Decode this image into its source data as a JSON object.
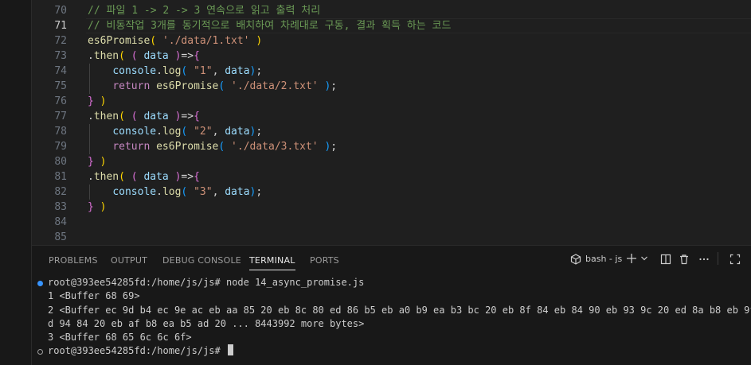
{
  "editor": {
    "lines": [
      {
        "n": "70",
        "segments": [
          {
            "c": "cm",
            "t": "// 파일 1 -> 2 -> 3 연속으로 읽고 출력 처리"
          }
        ]
      },
      {
        "n": "71",
        "active": true,
        "segments": [
          {
            "c": "cm",
            "t": "// 비동작업 3개를 동기적으로 배치하여 차례대로 구동, 결과 획득 하는 코드"
          }
        ]
      },
      {
        "n": "72",
        "segments": [
          {
            "c": "fn",
            "t": "es6Promise"
          },
          {
            "c": "b1",
            "t": "("
          },
          {
            "c": "pn",
            "t": " "
          },
          {
            "c": "str",
            "t": "'./data/1.txt'"
          },
          {
            "c": "pn",
            "t": " "
          },
          {
            "c": "b1",
            "t": ")"
          }
        ]
      },
      {
        "n": "73",
        "segments": [
          {
            "c": "pn",
            "t": "."
          },
          {
            "c": "fn",
            "t": "then"
          },
          {
            "c": "b1",
            "t": "("
          },
          {
            "c": "pn",
            "t": " "
          },
          {
            "c": "b2",
            "t": "("
          },
          {
            "c": "pn",
            "t": " "
          },
          {
            "c": "var",
            "t": "data"
          },
          {
            "c": "pn",
            "t": " "
          },
          {
            "c": "b2",
            "t": ")"
          },
          {
            "c": "op",
            "t": "=>"
          },
          {
            "c": "b2",
            "t": "{"
          }
        ]
      },
      {
        "n": "74",
        "guide": true,
        "segments": [
          {
            "c": "pn",
            "t": "    "
          },
          {
            "c": "var",
            "t": "console"
          },
          {
            "c": "pn",
            "t": "."
          },
          {
            "c": "fn",
            "t": "log"
          },
          {
            "c": "b3",
            "t": "("
          },
          {
            "c": "pn",
            "t": " "
          },
          {
            "c": "str",
            "t": "\"1\""
          },
          {
            "c": "pn",
            "t": ", "
          },
          {
            "c": "var",
            "t": "data"
          },
          {
            "c": "b3",
            "t": ")"
          },
          {
            "c": "pn",
            "t": ";"
          }
        ]
      },
      {
        "n": "75",
        "guide": true,
        "segments": [
          {
            "c": "pn",
            "t": "    "
          },
          {
            "c": "kw",
            "t": "return"
          },
          {
            "c": "pn",
            "t": " "
          },
          {
            "c": "fn",
            "t": "es6Promise"
          },
          {
            "c": "b3",
            "t": "("
          },
          {
            "c": "pn",
            "t": " "
          },
          {
            "c": "str",
            "t": "'./data/2.txt'"
          },
          {
            "c": "pn",
            "t": " "
          },
          {
            "c": "b3",
            "t": ")"
          },
          {
            "c": "pn",
            "t": ";"
          }
        ]
      },
      {
        "n": "76",
        "segments": [
          {
            "c": "b2",
            "t": "}"
          },
          {
            "c": "pn",
            "t": " "
          },
          {
            "c": "b1",
            "t": ")"
          }
        ]
      },
      {
        "n": "77",
        "segments": [
          {
            "c": "pn",
            "t": "."
          },
          {
            "c": "fn",
            "t": "then"
          },
          {
            "c": "b1",
            "t": "("
          },
          {
            "c": "pn",
            "t": " "
          },
          {
            "c": "b2",
            "t": "("
          },
          {
            "c": "pn",
            "t": " "
          },
          {
            "c": "var",
            "t": "data"
          },
          {
            "c": "pn",
            "t": " "
          },
          {
            "c": "b2",
            "t": ")"
          },
          {
            "c": "op",
            "t": "=>"
          },
          {
            "c": "b2",
            "t": "{"
          }
        ]
      },
      {
        "n": "78",
        "guide": true,
        "segments": [
          {
            "c": "pn",
            "t": "    "
          },
          {
            "c": "var",
            "t": "console"
          },
          {
            "c": "pn",
            "t": "."
          },
          {
            "c": "fn",
            "t": "log"
          },
          {
            "c": "b3",
            "t": "("
          },
          {
            "c": "pn",
            "t": " "
          },
          {
            "c": "str",
            "t": "\"2\""
          },
          {
            "c": "pn",
            "t": ", "
          },
          {
            "c": "var",
            "t": "data"
          },
          {
            "c": "b3",
            "t": ")"
          },
          {
            "c": "pn",
            "t": ";"
          }
        ]
      },
      {
        "n": "79",
        "guide": true,
        "segments": [
          {
            "c": "pn",
            "t": "    "
          },
          {
            "c": "kw",
            "t": "return"
          },
          {
            "c": "pn",
            "t": " "
          },
          {
            "c": "fn",
            "t": "es6Promise"
          },
          {
            "c": "b3",
            "t": "("
          },
          {
            "c": "pn",
            "t": " "
          },
          {
            "c": "str",
            "t": "'./data/3.txt'"
          },
          {
            "c": "pn",
            "t": " "
          },
          {
            "c": "b3",
            "t": ")"
          },
          {
            "c": "pn",
            "t": ";"
          }
        ]
      },
      {
        "n": "80",
        "segments": [
          {
            "c": "b2",
            "t": "}"
          },
          {
            "c": "pn",
            "t": " "
          },
          {
            "c": "b1",
            "t": ")"
          }
        ]
      },
      {
        "n": "81",
        "segments": [
          {
            "c": "pn",
            "t": "."
          },
          {
            "c": "fn",
            "t": "then"
          },
          {
            "c": "b1",
            "t": "("
          },
          {
            "c": "pn",
            "t": " "
          },
          {
            "c": "b2",
            "t": "("
          },
          {
            "c": "pn",
            "t": " "
          },
          {
            "c": "var",
            "t": "data"
          },
          {
            "c": "pn",
            "t": " "
          },
          {
            "c": "b2",
            "t": ")"
          },
          {
            "c": "op",
            "t": "=>"
          },
          {
            "c": "b2",
            "t": "{"
          }
        ]
      },
      {
        "n": "82",
        "guide": true,
        "segments": [
          {
            "c": "pn",
            "t": "    "
          },
          {
            "c": "var",
            "t": "console"
          },
          {
            "c": "pn",
            "t": "."
          },
          {
            "c": "fn",
            "t": "log"
          },
          {
            "c": "b3",
            "t": "("
          },
          {
            "c": "pn",
            "t": " "
          },
          {
            "c": "str",
            "t": "\"3\""
          },
          {
            "c": "pn",
            "t": ", "
          },
          {
            "c": "var",
            "t": "data"
          },
          {
            "c": "b3",
            "t": ")"
          },
          {
            "c": "pn",
            "t": ";"
          }
        ]
      },
      {
        "n": "83",
        "segments": [
          {
            "c": "b2",
            "t": "}"
          },
          {
            "c": "pn",
            "t": " "
          },
          {
            "c": "b1",
            "t": ")"
          }
        ]
      },
      {
        "n": "84",
        "segments": []
      },
      {
        "n": "85",
        "segments": []
      }
    ]
  },
  "panel": {
    "tabs": [
      {
        "key": "problems",
        "label": "PROBLEMS"
      },
      {
        "key": "output",
        "label": "OUTPUT"
      },
      {
        "key": "debug-console",
        "label": "DEBUG CONSOLE"
      },
      {
        "key": "terminal",
        "label": "TERMINAL",
        "active": true
      },
      {
        "key": "ports",
        "label": "PORTS"
      }
    ],
    "terminal_name": "bash - js",
    "icons": [
      "terminal-icon",
      "add-icon",
      "chevron-down-icon",
      "split-icon",
      "trash-icon",
      "more-icon",
      "maximize-icon",
      "close-icon"
    ]
  },
  "terminal": {
    "lines": [
      {
        "dot": "blue",
        "text": "root@393ee54285fd:/home/js/js# node 14_async_promise.js"
      },
      {
        "text": "1 <Buffer 68 69>"
      },
      {
        "text": "2 <Buffer ec 9d b4 ec 9e ac eb aa 85 20 eb 8c 80 ed 86 b5 eb a0 b9 ea b3 bc 20 eb 8f 84 eb 84 90 eb 93 9c 20 ed 8a b8 eb 9f bc"
      },
      {
        "text": "d 94 84 20 eb af b8 ea b5 ad 20 ... 8443992 more bytes>"
      },
      {
        "text": "3 <Buffer 68 65 6c 6c 6f>"
      },
      {
        "dot": "gray",
        "text": "root@393ee54285fd:/home/js/js# ",
        "cursor": true
      }
    ]
  },
  "colors": {
    "background": "#1f1f1f",
    "panel": "#181818",
    "comment": "#6a9955",
    "function": "#dcdcaa",
    "string": "#ce9178",
    "variable": "#9cdcfe",
    "keyword": "#c586c0",
    "bracket1": "#ffd700",
    "bracket2": "#da70d6",
    "bracket3": "#179fff",
    "success_dot": "#3794ff"
  }
}
